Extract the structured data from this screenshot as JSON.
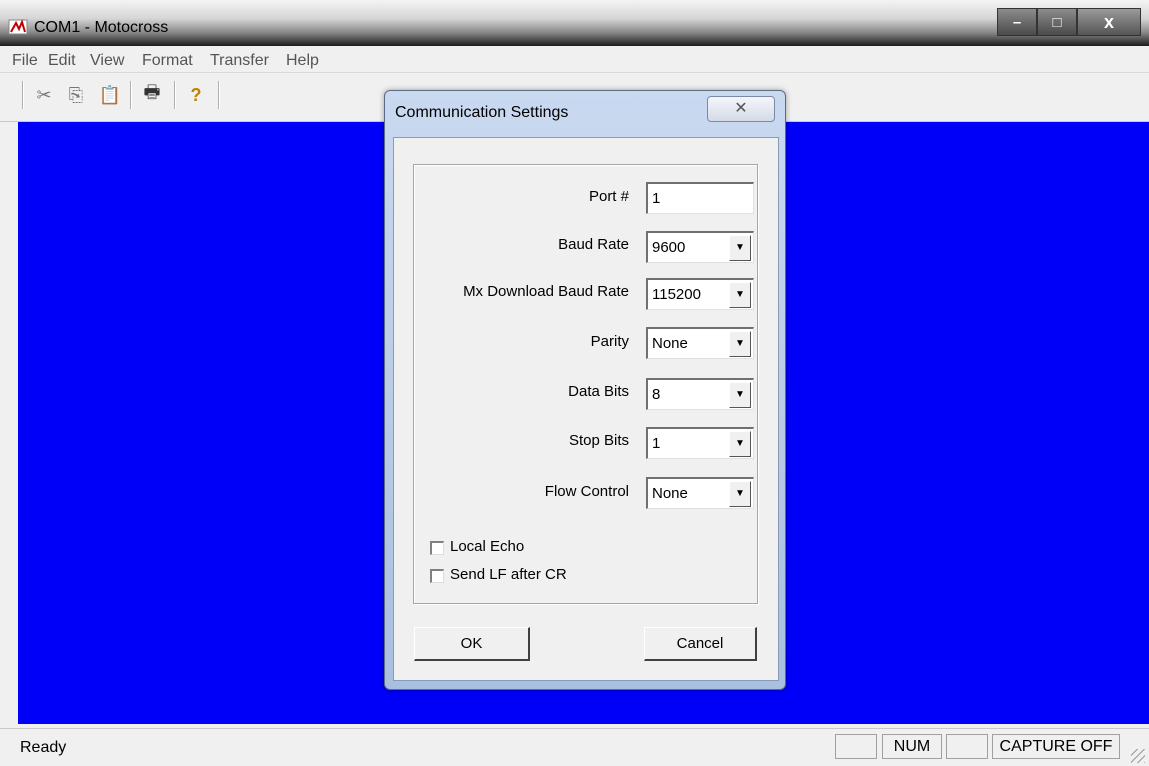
{
  "window": {
    "title": "COM1 - Motocross",
    "controls": {
      "minimize": "–",
      "maximize": "□",
      "close": "x"
    }
  },
  "menubar": {
    "items": [
      {
        "label": "File"
      },
      {
        "label": "Edit"
      },
      {
        "label": "View"
      },
      {
        "label": "Format"
      },
      {
        "label": "Transfer"
      },
      {
        "label": "Help"
      }
    ]
  },
  "toolbar": {
    "icons": [
      "cut-icon",
      "copy-icon",
      "paste-icon",
      "print-icon",
      "help-icon"
    ],
    "glyphs": {
      "cut": "✂",
      "copy": "⎘",
      "paste": "📋",
      "print": "🖶",
      "help": "?"
    }
  },
  "client": {
    "background": "#0000f8"
  },
  "dialog": {
    "title": "Communication Settings",
    "close_glyph": "✕",
    "fields": {
      "port": {
        "label": "Port #",
        "value": "1"
      },
      "baud_rate": {
        "label": "Baud Rate",
        "value": "9600"
      },
      "mx_download_baud_rate": {
        "label": "Mx Download Baud Rate",
        "value": "115200"
      },
      "parity": {
        "label": "Parity",
        "value": "None"
      },
      "data_bits": {
        "label": "Data Bits",
        "value": "8"
      },
      "stop_bits": {
        "label": "Stop Bits",
        "value": "1"
      },
      "flow_control": {
        "label": "Flow Control",
        "value": "None"
      }
    },
    "checkboxes": {
      "local_echo": {
        "label": "Local Echo",
        "checked": false
      },
      "send_lf_after_cr": {
        "label": "Send LF after CR",
        "checked": false
      }
    },
    "buttons": {
      "ok": "OK",
      "cancel": "Cancel"
    }
  },
  "statusbar": {
    "text": "Ready",
    "panes": [
      "",
      "NUM",
      "",
      "CAPTURE OFF"
    ]
  }
}
